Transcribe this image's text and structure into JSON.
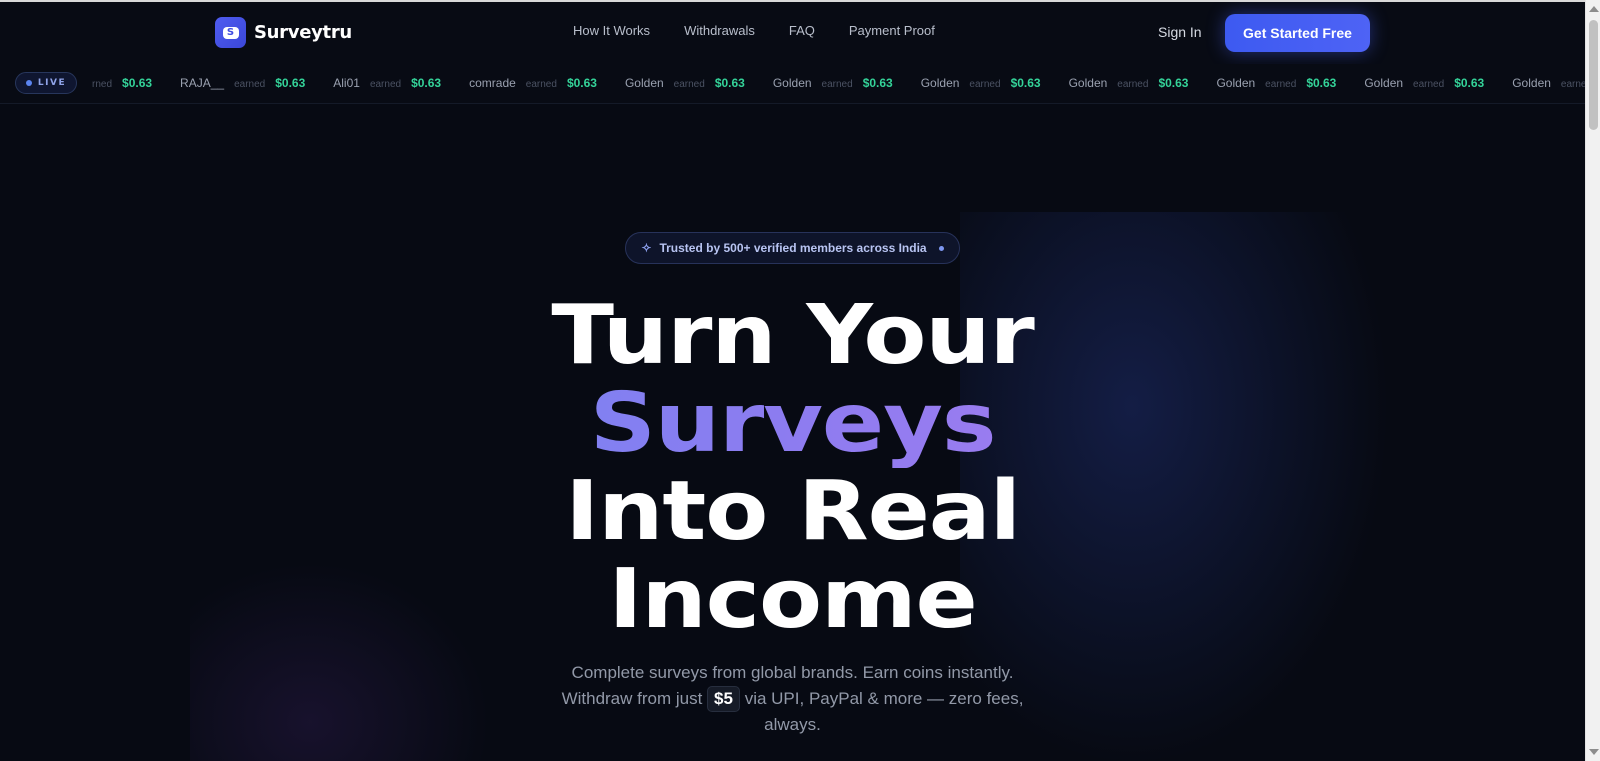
{
  "header": {
    "brand": "Surveytru",
    "logo_letter": "S",
    "nav": [
      "How It Works",
      "Withdrawals",
      "FAQ",
      "Payment Proof"
    ],
    "signin": "Sign In",
    "cta": "Get Started Free"
  },
  "ticker": {
    "live_label": "LIVE",
    "items": [
      {
        "name": "",
        "earned": "rned",
        "amount": "$0.63"
      },
      {
        "name": "RAJA__",
        "earned": "earned",
        "amount": "$0.63"
      },
      {
        "name": "Ali01",
        "earned": "earned",
        "amount": "$0.63"
      },
      {
        "name": "comrade",
        "earned": "earned",
        "amount": "$0.63"
      },
      {
        "name": "Golden",
        "earned": "earned",
        "amount": "$0.63"
      },
      {
        "name": "Golden",
        "earned": "earned",
        "amount": "$0.63"
      },
      {
        "name": "Golden",
        "earned": "earned",
        "amount": "$0.63"
      },
      {
        "name": "Golden",
        "earned": "earned",
        "amount": "$0.63"
      },
      {
        "name": "Golden",
        "earned": "earned",
        "amount": "$0.63"
      },
      {
        "name": "Golden",
        "earned": "earned",
        "amount": "$0.63"
      },
      {
        "name": "Golden",
        "earned": "earned",
        "amount": ""
      }
    ]
  },
  "hero": {
    "badge": "Trusted by 500+ verified members across India",
    "line1": "Turn Your",
    "line2": "Surveys",
    "line3": "Into Real",
    "line4": "Income",
    "sub_part1": "Complete surveys from global brands. Earn coins instantly. Withdraw from just",
    "sub_amount": "$5",
    "sub_part2": "via UPI, PayPal & more — zero fees, always."
  },
  "colors": {
    "background": "#070a13",
    "accent": "#3d5af1",
    "earn_green": "#34d399"
  }
}
